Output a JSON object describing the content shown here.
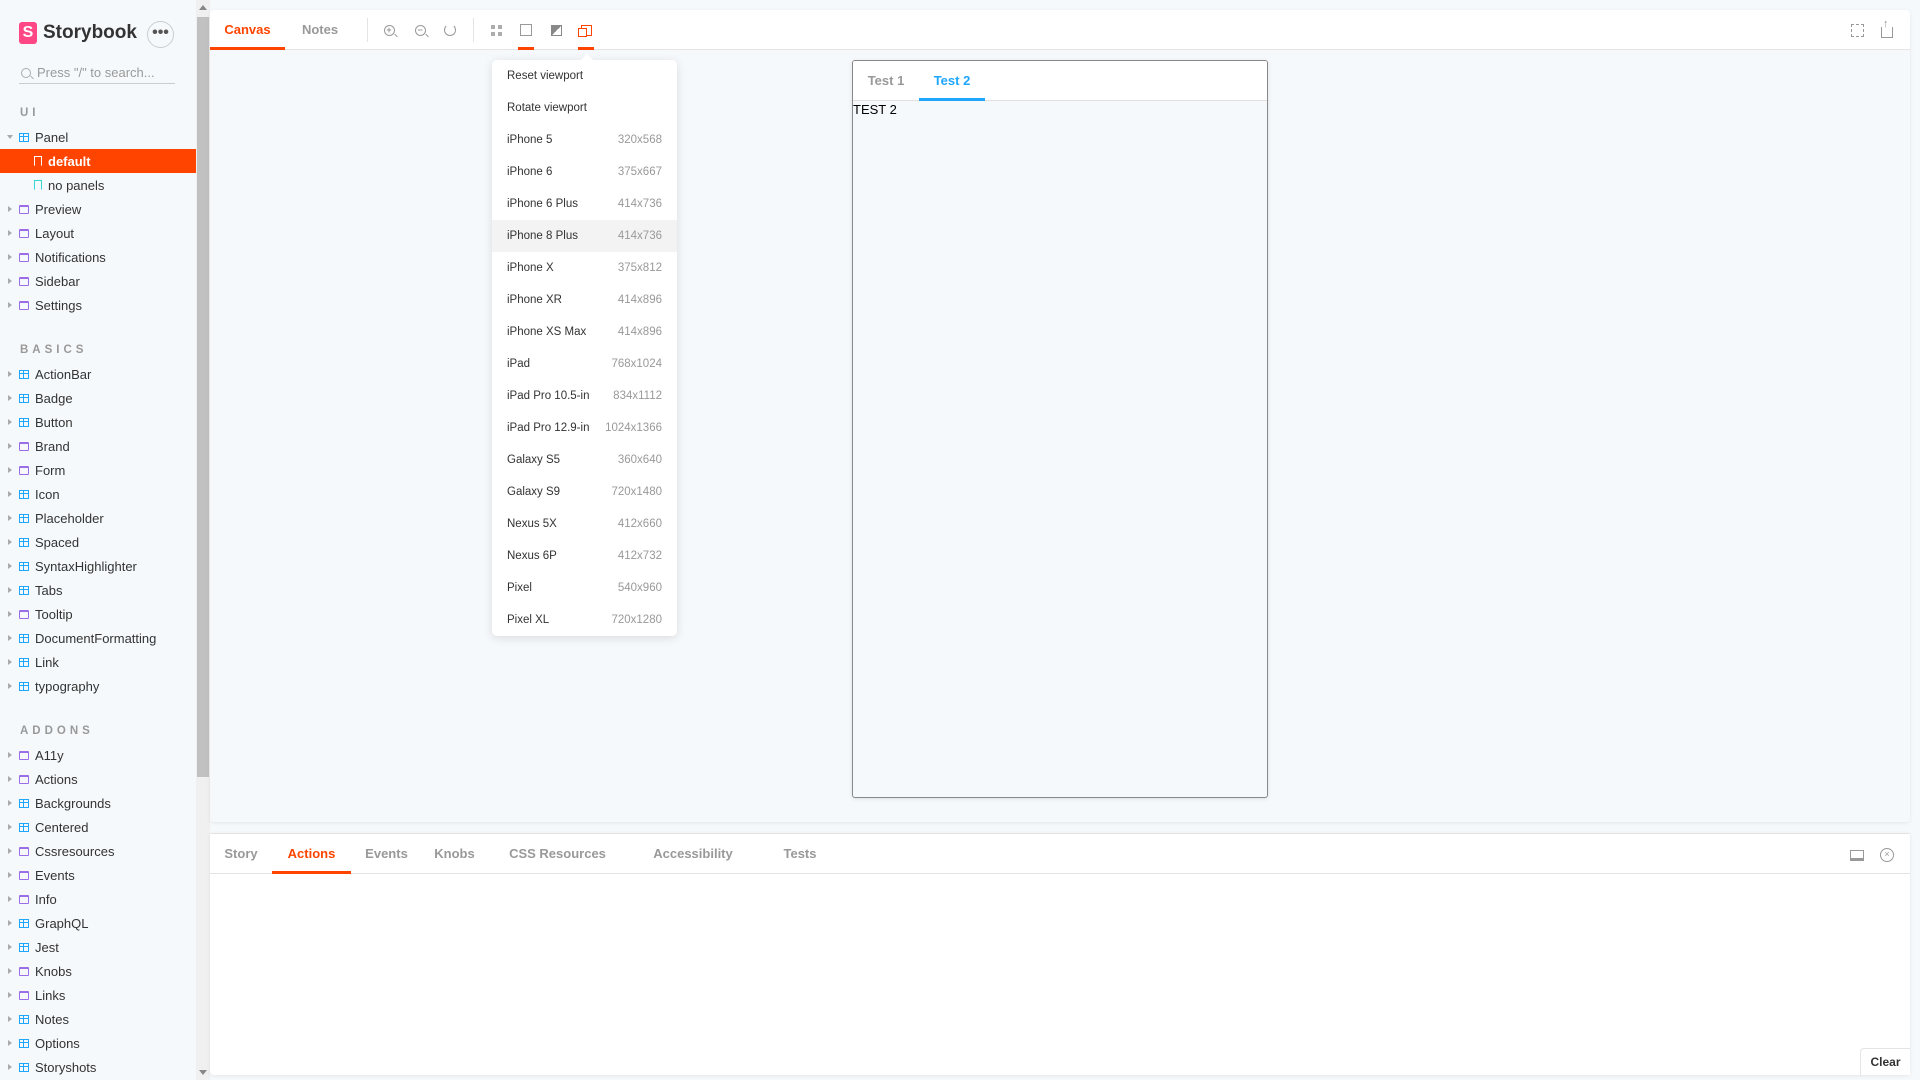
{
  "brand": {
    "name": "Storybook",
    "logo_letter": "S",
    "accent": "#ff4400",
    "secondary": "#1ea7fd"
  },
  "sidebar": {
    "more_label": "•••",
    "search_placeholder": "Press \"/\" to search...",
    "sections": [
      {
        "title": "UI",
        "items": [
          {
            "label": "Panel",
            "type": "component",
            "expanded": true,
            "children": [
              {
                "label": "default",
                "selected": true
              },
              {
                "label": "no panels",
                "selected": false
              }
            ]
          },
          {
            "label": "Preview",
            "type": "folder"
          },
          {
            "label": "Layout",
            "type": "folder"
          },
          {
            "label": "Notifications",
            "type": "folder"
          },
          {
            "label": "Sidebar",
            "type": "folder"
          },
          {
            "label": "Settings",
            "type": "folder"
          }
        ]
      },
      {
        "title": "BASICS",
        "items": [
          {
            "label": "ActionBar",
            "type": "component"
          },
          {
            "label": "Badge",
            "type": "component"
          },
          {
            "label": "Button",
            "type": "component"
          },
          {
            "label": "Brand",
            "type": "folder"
          },
          {
            "label": "Form",
            "type": "folder"
          },
          {
            "label": "Icon",
            "type": "component"
          },
          {
            "label": "Placeholder",
            "type": "component"
          },
          {
            "label": "Spaced",
            "type": "component"
          },
          {
            "label": "SyntaxHighlighter",
            "type": "component"
          },
          {
            "label": "Tabs",
            "type": "component"
          },
          {
            "label": "Tooltip",
            "type": "folder"
          },
          {
            "label": "DocumentFormatting",
            "type": "component"
          },
          {
            "label": "Link",
            "type": "component"
          },
          {
            "label": "typography",
            "type": "component"
          }
        ]
      },
      {
        "title": "ADDONS",
        "items": [
          {
            "label": "A11y",
            "type": "folder"
          },
          {
            "label": "Actions",
            "type": "folder"
          },
          {
            "label": "Backgrounds",
            "type": "component"
          },
          {
            "label": "Centered",
            "type": "component"
          },
          {
            "label": "Cssresources",
            "type": "folder"
          },
          {
            "label": "Events",
            "type": "folder"
          },
          {
            "label": "Info",
            "type": "folder"
          },
          {
            "label": "GraphQL",
            "type": "component"
          },
          {
            "label": "Jest",
            "type": "component"
          },
          {
            "label": "Knobs",
            "type": "folder"
          },
          {
            "label": "Links",
            "type": "folder"
          },
          {
            "label": "Notes",
            "type": "component"
          },
          {
            "label": "Options",
            "type": "component"
          },
          {
            "label": "Storyshots",
            "type": "component"
          }
        ]
      }
    ]
  },
  "toolbar": {
    "tabs": [
      {
        "label": "Canvas",
        "active": true
      },
      {
        "label": "Notes",
        "active": false
      }
    ],
    "icons": [
      "zoom-in-icon",
      "zoom-out-icon",
      "zoom-reset-icon",
      "grid-icon",
      "background-image-icon",
      "contrast-icon",
      "viewport-icon",
      "fullscreen-icon",
      "share-icon"
    ],
    "active_tools": [
      "background-image-icon",
      "viewport-icon"
    ]
  },
  "viewport_menu": {
    "items": [
      {
        "label": "Reset viewport",
        "size": ""
      },
      {
        "label": "Rotate viewport",
        "size": ""
      },
      {
        "label": "iPhone 5",
        "size": "320x568"
      },
      {
        "label": "iPhone 6",
        "size": "375x667"
      },
      {
        "label": "iPhone 6 Plus",
        "size": "414x736"
      },
      {
        "label": "iPhone 8 Plus",
        "size": "414x736",
        "hovered": true
      },
      {
        "label": "iPhone X",
        "size": "375x812"
      },
      {
        "label": "iPhone XR",
        "size": "414x896"
      },
      {
        "label": "iPhone XS Max",
        "size": "414x896"
      },
      {
        "label": "iPad",
        "size": "768x1024"
      },
      {
        "label": "iPad Pro 10.5-in",
        "size": "834x1112"
      },
      {
        "label": "iPad Pro 12.9-in",
        "size": "1024x1366"
      },
      {
        "label": "Galaxy S5",
        "size": "360x640"
      },
      {
        "label": "Galaxy S9",
        "size": "720x1480"
      },
      {
        "label": "Nexus 5X",
        "size": "412x660"
      },
      {
        "label": "Nexus 6P",
        "size": "412x732"
      },
      {
        "label": "Pixel",
        "size": "540x960"
      },
      {
        "label": "Pixel XL",
        "size": "720x1280"
      }
    ]
  },
  "preview": {
    "tabs": [
      {
        "label": "Test 1",
        "active": false
      },
      {
        "label": "Test 2",
        "active": true
      }
    ],
    "content": "TEST 2"
  },
  "addons_panel": {
    "tabs": [
      {
        "label": "Story",
        "active": false
      },
      {
        "label": "Actions",
        "active": true
      },
      {
        "label": "Events",
        "active": false
      },
      {
        "label": "Knobs",
        "active": false
      },
      {
        "label": "CSS Resources",
        "active": false
      },
      {
        "label": "Accessibility",
        "active": false
      },
      {
        "label": "Tests",
        "active": false
      }
    ],
    "clear_label": "Clear"
  }
}
